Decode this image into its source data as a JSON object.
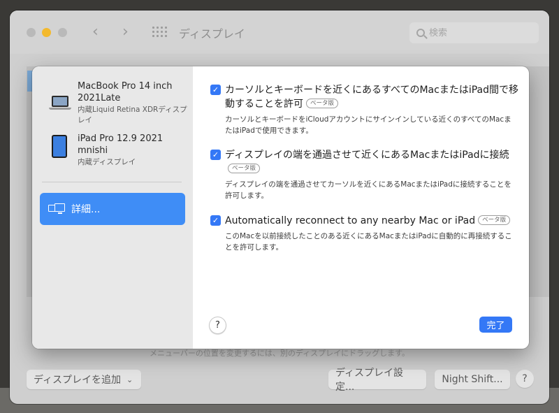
{
  "window": {
    "title": "ディスプレイ",
    "search_placeholder": "検索",
    "back_hint": "メニューバーの位置を変更するには、別のディスプレイにドラッグします。",
    "add_display_label": "ディスプレイを追加",
    "display_settings_label": "ディスプレイ設定...",
    "night_shift_label": "Night Shift...",
    "help_label": "?"
  },
  "sidebar": {
    "devices": [
      {
        "name": "MacBook Pro 14 inch 2021Late",
        "sub": "内蔵Liquid Retina XDRディスプレイ",
        "icon": "laptop-icon"
      },
      {
        "name": "iPad Pro 12.9 2021 mnishi",
        "sub": "内蔵ディスプレイ",
        "icon": "ipad-icon"
      }
    ],
    "detail_label": "詳細..."
  },
  "options": [
    {
      "checked": true,
      "title": "カーソルとキーボードを近くにあるすべてのMacまたはiPad間で移動することを許可",
      "badge": "ベータ版",
      "desc": "カーソルとキーボードをiCloudアカウントにサインインしている近くのすべてのMacまたはiPadで使用できます。"
    },
    {
      "checked": true,
      "title": "ディスプレイの端を通過させて近くにあるMacまたはiPadに接続",
      "badge": "ベータ版",
      "desc": "ディスプレイの端を通過させてカーソルを近くにあるMacまたはiPadに接続することを許可します。"
    },
    {
      "checked": true,
      "title": "Automatically reconnect to any nearby Mac or iPad",
      "badge": "ベータ版",
      "desc": "このMacを以前接続したことのある近くにあるMacまたはiPadに自動的に再接続することを許可します。"
    }
  ],
  "sheet": {
    "help_label": "?",
    "done_label": "完了"
  },
  "colors": {
    "accent": "#3478f6",
    "sidebar_selected": "#3f8df6",
    "traffic_yellow": "#f3b92d"
  }
}
